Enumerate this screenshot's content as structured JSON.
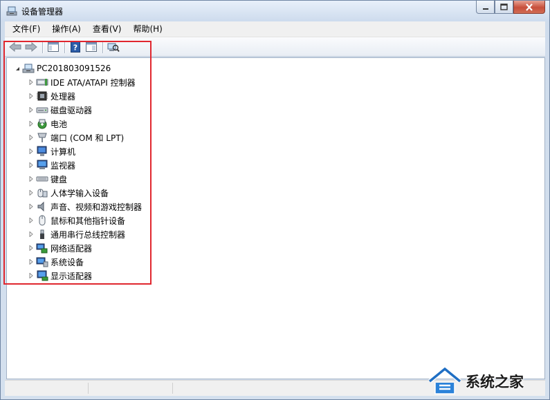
{
  "window": {
    "title": "设备管理器",
    "controls": {
      "minimize": "minimize",
      "maximize": "maximize",
      "close": "close"
    }
  },
  "menubar": {
    "items": [
      {
        "label": "文件(F)"
      },
      {
        "label": "操作(A)"
      },
      {
        "label": "查看(V)"
      },
      {
        "label": "帮助(H)"
      }
    ]
  },
  "toolbar": {
    "buttons": [
      {
        "icon": "back-arrow-icon"
      },
      {
        "icon": "forward-arrow-icon"
      },
      {
        "icon": "console-tree-icon"
      },
      {
        "icon": "help-icon"
      },
      {
        "icon": "properties-icon"
      },
      {
        "icon": "scan-hardware-icon"
      }
    ]
  },
  "tree": {
    "root": {
      "label": "PC201803091526",
      "icon": "computer-icon",
      "expanded": true
    },
    "categories": [
      {
        "label": "IDE ATA/ATAPI 控制器",
        "icon": "ide-controller-icon"
      },
      {
        "label": "处理器",
        "icon": "processor-icon"
      },
      {
        "label": "磁盘驱动器",
        "icon": "disk-drive-icon"
      },
      {
        "label": "电池",
        "icon": "battery-icon"
      },
      {
        "label": "端口 (COM 和 LPT)",
        "icon": "port-icon"
      },
      {
        "label": "计算机",
        "icon": "computer-icon"
      },
      {
        "label": "监视器",
        "icon": "monitor-icon"
      },
      {
        "label": "键盘",
        "icon": "keyboard-icon"
      },
      {
        "label": "人体学输入设备",
        "icon": "hid-icon"
      },
      {
        "label": "声音、视频和游戏控制器",
        "icon": "sound-icon"
      },
      {
        "label": "鼠标和其他指针设备",
        "icon": "mouse-icon"
      },
      {
        "label": "通用串行总线控制器",
        "icon": "usb-icon"
      },
      {
        "label": "网络适配器",
        "icon": "network-adapter-icon"
      },
      {
        "label": "系统设备",
        "icon": "system-device-icon"
      },
      {
        "label": "显示适配器",
        "icon": "display-adapter-icon"
      }
    ]
  },
  "colors": {
    "highlight": "#e0262e",
    "titlebar": "#cddbed"
  },
  "watermark": {
    "text": "系统之家"
  }
}
